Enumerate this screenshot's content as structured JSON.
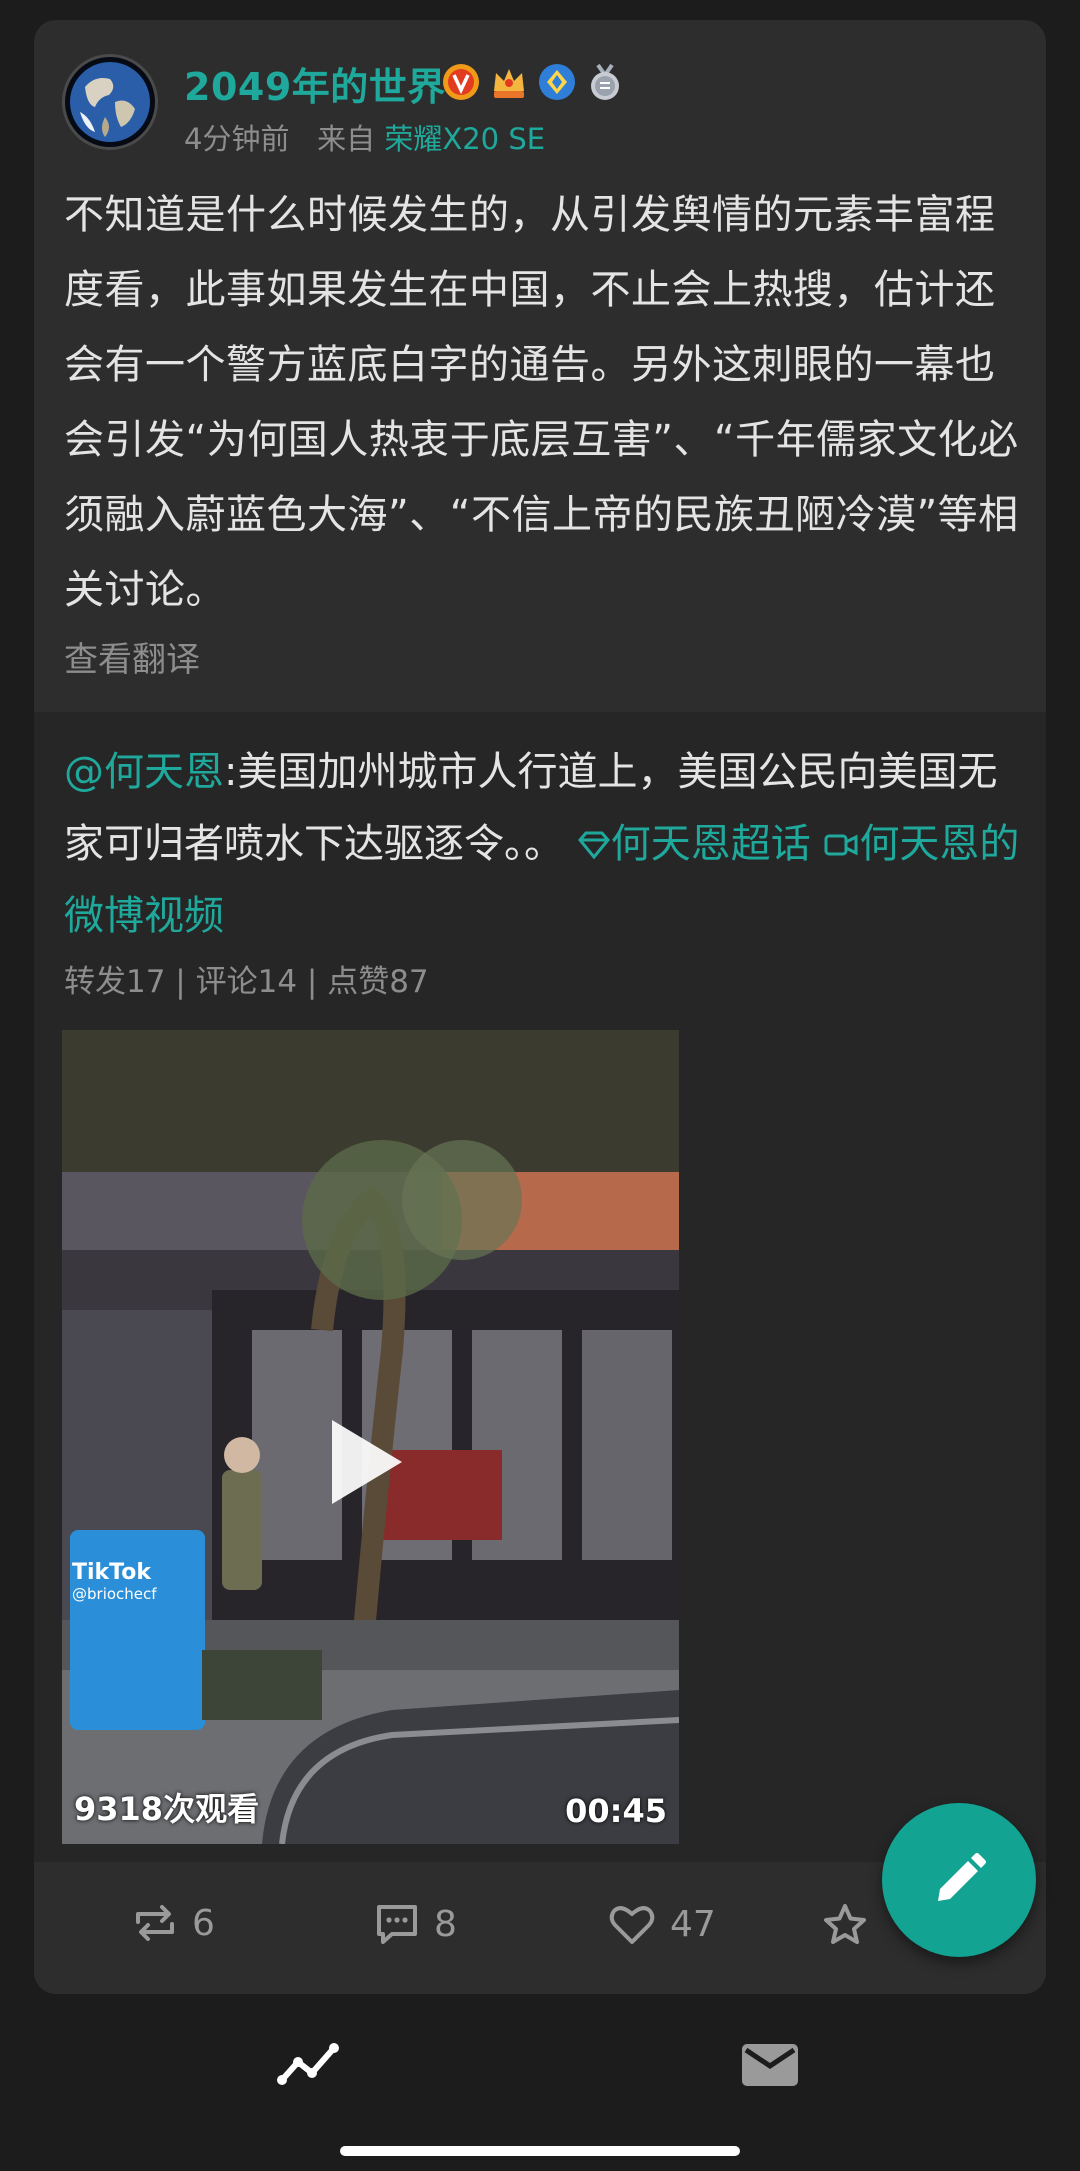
{
  "post": {
    "username": "2049年的世界",
    "time": "4分钟前",
    "from_label": "来自",
    "device": "荣耀X20 SE",
    "text": "不知道是什么时候发生的，从引发舆情的元素丰富程度看，此事如果发生在中国，不止会上热搜，估计还会有一个警方蓝底白字的通告。另外这刺眼的一幕也会引发“为何国人热衷于底层互害”、“千年儒家文化必须融入蔚蓝色大海”、“不信上帝的民族丑陋冷漠”等相关讨论。",
    "translate": "查看翻译"
  },
  "repost": {
    "mention": "@何天恩",
    "text": ":美国加州城市人行道上，美国公民向美国无家可归者喷水下达驱逐令。。",
    "topic_link": "何天恩超话",
    "video_link": "何天恩的微博视频",
    "stats": "转发17 | 评论14 | 点赞87",
    "video": {
      "views": "9318次观看",
      "duration": "00:45",
      "watermark": "TikTok",
      "watermark_user": "@briochecf"
    }
  },
  "actions": {
    "repost_count": "6",
    "comment_count": "8",
    "like_count": "47"
  },
  "icons": [
    "verified-v-icon",
    "crown-badge-icon",
    "diamond-badge-icon",
    "medal-badge-icon",
    "repost-icon",
    "comment-icon",
    "heart-icon",
    "star-icon",
    "edit-pencil-icon",
    "trend-icon",
    "mail-icon",
    "topic-diamond-icon",
    "video-camera-icon",
    "play-icon"
  ],
  "colors": {
    "accent": "#1fa99c",
    "fab": "#12a393",
    "card": "#2d2d2d",
    "background": "#1c1c1c"
  }
}
